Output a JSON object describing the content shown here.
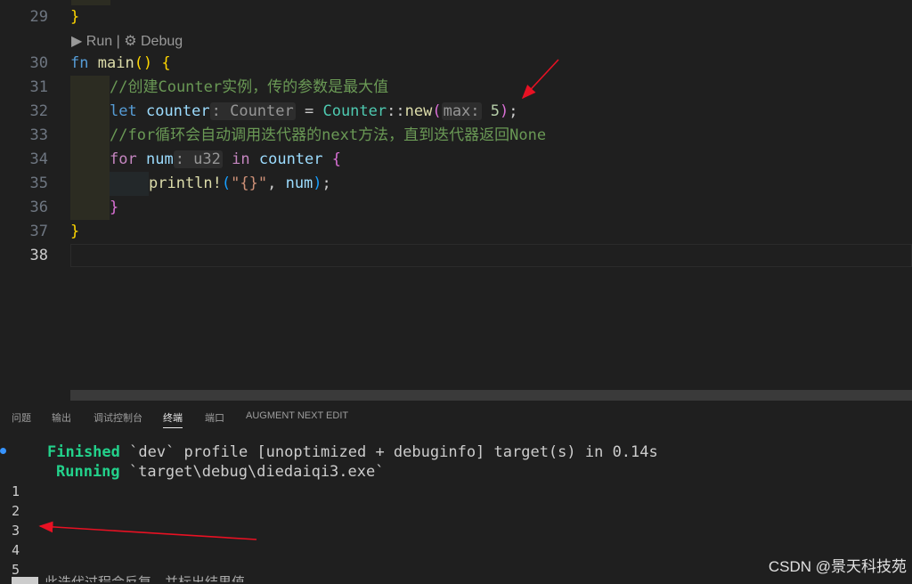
{
  "editor": {
    "line_numbers": [
      "29",
      "30",
      "31",
      "32",
      "33",
      "34",
      "35",
      "36",
      "37",
      "38"
    ],
    "codelens": {
      "run": "Run",
      "separator": "|",
      "debug": "Debug"
    },
    "lines": {
      "l29_close": "}",
      "l30": {
        "kw": "fn",
        "name": "main",
        "parens": "()",
        "brace": "{"
      },
      "l31_comment": "//创建Counter实例，传的参数是最大值",
      "l32": {
        "kw": "let",
        "var": "counter",
        "hint_type": ": Counter",
        "eq": " = ",
        "type": "Counter",
        "sep": "::",
        "fn": "new",
        "open": "(",
        "hint_param": "max:",
        "arg": "5",
        "close": ")",
        "semi": ";"
      },
      "l33_comment": "//for循环会自动调用迭代器的next方法，直到迭代器返回None",
      "l34": {
        "kw": "for",
        "var": "num",
        "hint_type": ": u32",
        "kw2": "in",
        "var2": "counter",
        "brace": "{"
      },
      "l35": {
        "macro": "println!",
        "open": "(",
        "str": "\"{}\"",
        "comma": ", ",
        "var": "num",
        "close": ")",
        "semi": ";"
      },
      "l36_close": "}",
      "l37_close": "}"
    }
  },
  "panel": {
    "tabs": [
      "问题",
      "输出",
      "调试控制台",
      "终端",
      "端口",
      "AUGMENT NEXT EDIT"
    ],
    "active_tab": "终端",
    "terminal": {
      "finished_label": "Finished",
      "finished_rest": " `dev` profile [unoptimized + debuginfo] target(s) in 0.14s",
      "running_label": "Running",
      "running_rest": " `target\\debug\\diedaiqi3.exe`",
      "outputs": [
        "1",
        "2",
        "3",
        "4",
        "5"
      ],
      "cut_line": "此迭代过程会反复，并标出结果值"
    }
  },
  "watermark": "CSDN @景天科技苑",
  "colors": {
    "background": "#1f1f1f",
    "arrow": "#e81123",
    "accent": "#3794ff"
  }
}
